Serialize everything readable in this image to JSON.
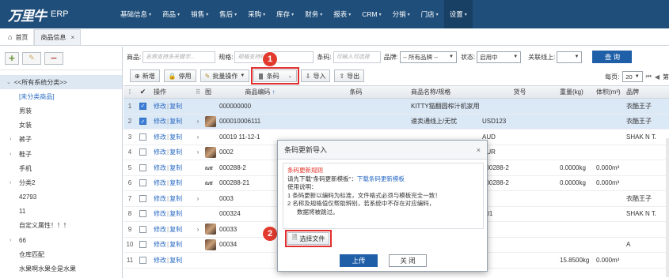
{
  "app": {
    "brand": "万里牛",
    "product": "ERP"
  },
  "nav": [
    {
      "label": "基础信息",
      "caret": true
    },
    {
      "label": "商品",
      "caret": true
    },
    {
      "label": "销售",
      "caret": true
    },
    {
      "label": "售后",
      "caret": true
    },
    {
      "label": "采购",
      "caret": true
    },
    {
      "label": "库存",
      "caret": true
    },
    {
      "label": "财务",
      "caret": true
    },
    {
      "label": "报表",
      "caret": true
    },
    {
      "label": "CRM",
      "caret": true
    },
    {
      "label": "分销",
      "caret": true
    },
    {
      "label": "门店",
      "caret": true
    },
    {
      "label": "设置",
      "caret": true
    }
  ],
  "tabs": {
    "home": "首页",
    "active": "商品信息"
  },
  "tree": {
    "root": "<<所有系统分类>>",
    "items": [
      {
        "label": "[未分类商品]",
        "arrow": false,
        "selected": true
      },
      {
        "label": "男装",
        "arrow": false
      },
      {
        "label": "女装",
        "arrow": false
      },
      {
        "label": "裤子",
        "arrow": true
      },
      {
        "label": "鞋子",
        "arrow": true
      },
      {
        "label": "手机",
        "arrow": false
      },
      {
        "label": "分类2",
        "arrow": true
      },
      {
        "label": "42793",
        "arrow": false
      },
      {
        "label": "11",
        "arrow": false
      },
      {
        "label": "自定义属性！！！",
        "arrow": false
      },
      {
        "label": "66",
        "arrow": true
      },
      {
        "label": "仓库匹配",
        "arrow": false
      },
      {
        "label": "水果啊水果全是水果",
        "arrow": false
      }
    ]
  },
  "filters": {
    "product_label": "商品:",
    "product_placeholder": "名称支持多关键字...",
    "spec_label": "规格:",
    "spec_placeholder": "规格支持模糊...",
    "barcode_label": "条码:",
    "barcode_placeholder": "可输入可选择",
    "brand_label": "品牌:",
    "brand_value": "-- 所有品牌 --",
    "status_label": "状态:",
    "status_value": "启用中",
    "online_label": "关联线上:",
    "online_value": "",
    "search": "查 询"
  },
  "toolbar": {
    "add": "新增",
    "disable": "停用",
    "batch": "批量操作",
    "barcode": "条码",
    "import": "导入",
    "export": "导出"
  },
  "pager": {
    "label": "每页:",
    "value": "20"
  },
  "columns": {
    "no": "",
    "op": "操作",
    "img": "图",
    "code": "商品编码",
    "barcode": "条码",
    "name": "商品名称/规格",
    "goods_no": "货号",
    "weight": "重量(kg)",
    "volume": "体积(m³)",
    "brand": "品牌"
  },
  "rows": [
    {
      "no": "1",
      "checked": true,
      "ops": [
        "修改",
        "复制"
      ],
      "exp": "",
      "img": "",
      "code": "000000000",
      "barcode": "",
      "name": "KITTY猫翻圆榨汁机家用",
      "goods_no": "",
      "weight": "",
      "volume": "",
      "brand": "衣酷王子"
    },
    {
      "no": "2",
      "checked": true,
      "ops": [
        "修改",
        "复制"
      ],
      "exp": "›",
      "img": "photo",
      "code": "000010006111",
      "barcode": "",
      "name": "速卖通线上/无忧",
      "goods_no": "USD123",
      "weight": "",
      "volume": "",
      "brand": "衣酷王子"
    },
    {
      "no": "3",
      "checked": false,
      "ops": [
        "修改",
        "复制"
      ],
      "exp": "›",
      "img": "",
      "code": "00019 11-12-1",
      "barcode": "",
      "name": "",
      "goods_no": "AUD",
      "weight": "",
      "volume": "",
      "brand": "SHAK N TA"
    },
    {
      "no": "4",
      "checked": false,
      "ops": [
        "修改",
        "复制"
      ],
      "exp": "›",
      "img": "photo",
      "code": "0002",
      "barcode": "",
      "name": "",
      "goods_no": "EUR",
      "weight": "",
      "volume": "",
      "brand": ""
    },
    {
      "no": "5",
      "checked": false,
      "ops": [
        "修改",
        "复制"
      ],
      "exp": "",
      "img": "logo",
      "code": "000288-2",
      "barcode": "",
      "name": "",
      "goods_no": "000288-2",
      "weight": "0.0000kg",
      "volume": "0.000m³",
      "brand": ""
    },
    {
      "no": "6",
      "checked": false,
      "ops": [
        "修改",
        "复制"
      ],
      "exp": "",
      "img": "logo",
      "code": "000288-21",
      "barcode": "",
      "name": "",
      "goods_no": "000288-2",
      "weight": "0.0000kg",
      "volume": "0.000m³",
      "brand": ""
    },
    {
      "no": "7",
      "checked": false,
      "ops": [
        "修改",
        "复制"
      ],
      "exp": "›",
      "img": "",
      "code": "0003",
      "barcode": "",
      "name": "",
      "goods_no": "",
      "weight": "",
      "volume": "",
      "brand": "衣酷王子"
    },
    {
      "no": "8",
      "checked": false,
      "ops": [
        "修改",
        "复制"
      ],
      "exp": "",
      "img": "",
      "code": "000324",
      "barcode": "",
      "name": "",
      "goods_no": "b01",
      "weight": "",
      "volume": "",
      "brand": "SHAK N TA"
    },
    {
      "no": "9",
      "checked": false,
      "ops": [
        "修改",
        "复制"
      ],
      "exp": "›",
      "img": "photo",
      "code": "00033",
      "barcode": "",
      "name": "",
      "goods_no": "",
      "weight": "",
      "volume": "",
      "brand": ""
    },
    {
      "no": "10",
      "checked": false,
      "ops": [
        "修改",
        "复制"
      ],
      "exp": "",
      "img": "photo",
      "code": "00034",
      "barcode": "",
      "name": "",
      "goods_no": "",
      "weight": "",
      "volume": "",
      "brand": "A"
    },
    {
      "no": "11",
      "checked": false,
      "ops": [
        "修改",
        "复制"
      ],
      "exp": "",
      "img": "",
      "code": "",
      "barcode": "",
      "name": "",
      "goods_no": "",
      "weight": "15.8500kg",
      "volume": "0.000m³",
      "brand": ""
    }
  ],
  "dialog": {
    "title": "条码更新导入",
    "rules_title": "条码更新规则",
    "line1_pre": "请先下载\"条码更新模板\"：",
    "line1_link": "下载条码更新模板",
    "usage": "使用说明：",
    "rule1": "1 条码更新以编码为标准，文件格式必须与模板完全一致！",
    "rule2": "2 名称及规格值仅帮助辨别，若系统中不存在对应编码，",
    "rule2b": "数据将被跳过。",
    "choose_file": "选择文件",
    "ok": "上传",
    "cancel": "关 闭"
  },
  "steps": [
    "1",
    "2"
  ],
  "colors": {
    "nav_bg": "#1f4e7a",
    "primary": "#1f5fa8",
    "marker": "#e23b2e",
    "link": "#2b6cc4"
  }
}
